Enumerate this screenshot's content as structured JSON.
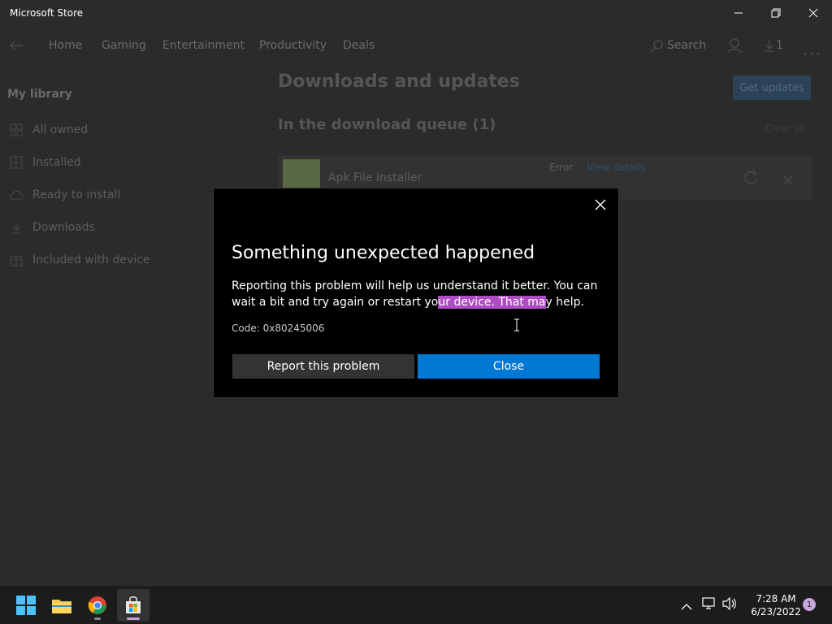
{
  "window": {
    "title": "Microsoft Store"
  },
  "nav": {
    "items": [
      "Home",
      "Gaming",
      "Entertainment",
      "Productivity",
      "Deals"
    ],
    "search_label": "Search",
    "downloads_count": "1"
  },
  "sidebar": {
    "heading": "My library",
    "items": [
      {
        "label": "All owned",
        "icon": "grid-icon"
      },
      {
        "label": "Installed",
        "icon": "apps-icon"
      },
      {
        "label": "Ready to install",
        "icon": "cloud-icon"
      },
      {
        "label": "Downloads",
        "icon": "download-icon"
      },
      {
        "label": "Included with device",
        "icon": "box-icon"
      }
    ]
  },
  "main": {
    "title": "Downloads and updates",
    "get_updates_label": "Get updates",
    "queue_title": "In the download queue (1)",
    "see_all_label": "Clear all",
    "download": {
      "name": "Apk File Installer",
      "status": "Error",
      "status_link": "View details"
    }
  },
  "dialog": {
    "title": "Something unexpected happened",
    "message_before": "Reporting this problem will help us understand it better. You can wait a bit and try again or restart yo",
    "message_highlight": "ur device. That ma",
    "message_after": "y help.",
    "code": "Code: 0x80245006",
    "report_label": "Report this problem",
    "close_label": "Close"
  },
  "taskbar": {
    "time": "7:28 AM",
    "date": "6/23/2022",
    "notification_count": "1"
  },
  "colors": {
    "accent": "#0078d4",
    "highlight": "#b04bc6",
    "dialog_bg": "#000000",
    "app_bg": "#2b2b2b"
  }
}
